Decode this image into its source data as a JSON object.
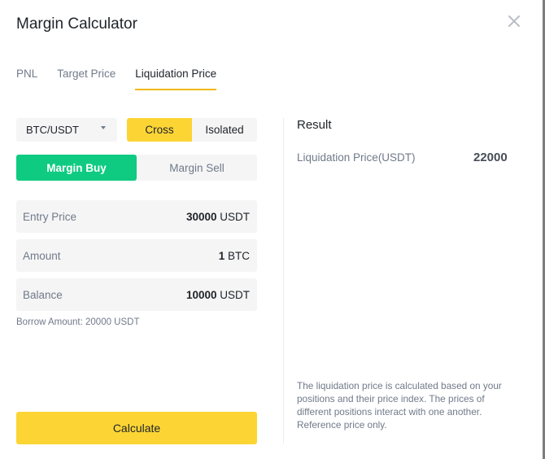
{
  "dialog": {
    "title": "Margin Calculator",
    "close_icon": "close-icon"
  },
  "tabs": [
    {
      "label": "PNL",
      "active": false
    },
    {
      "label": "Target Price",
      "active": false
    },
    {
      "label": "Liquidation Price",
      "active": true
    }
  ],
  "form": {
    "pair": {
      "value": "BTC/USDT",
      "icon": "chevron-down-icon"
    },
    "margin_mode": {
      "options": [
        "Cross",
        "Isolated"
      ],
      "selected": "Cross"
    },
    "side": {
      "options": [
        "Margin Buy",
        "Margin Sell"
      ],
      "selected": "Margin Buy"
    },
    "fields": [
      {
        "label": "Entry Price",
        "value": "30000",
        "unit": "USDT"
      },
      {
        "label": "Amount",
        "value": "1",
        "unit": "BTC"
      },
      {
        "label": "Balance",
        "value": "10000",
        "unit": "USDT"
      }
    ],
    "borrow_text": "Borrow Amount: 20000 USDT",
    "calculate_label": "Calculate"
  },
  "result": {
    "title": "Result",
    "label": "Liquidation Price(USDT)",
    "value": "22000",
    "note": "The liquidation price is calculated based on your positions and their price index. The prices of different positions interact with one another. Reference price only."
  },
  "colors": {
    "accent_yellow": "#fcd535",
    "tab_underline": "#f0b90b",
    "buy_green": "#0ecb81"
  }
}
